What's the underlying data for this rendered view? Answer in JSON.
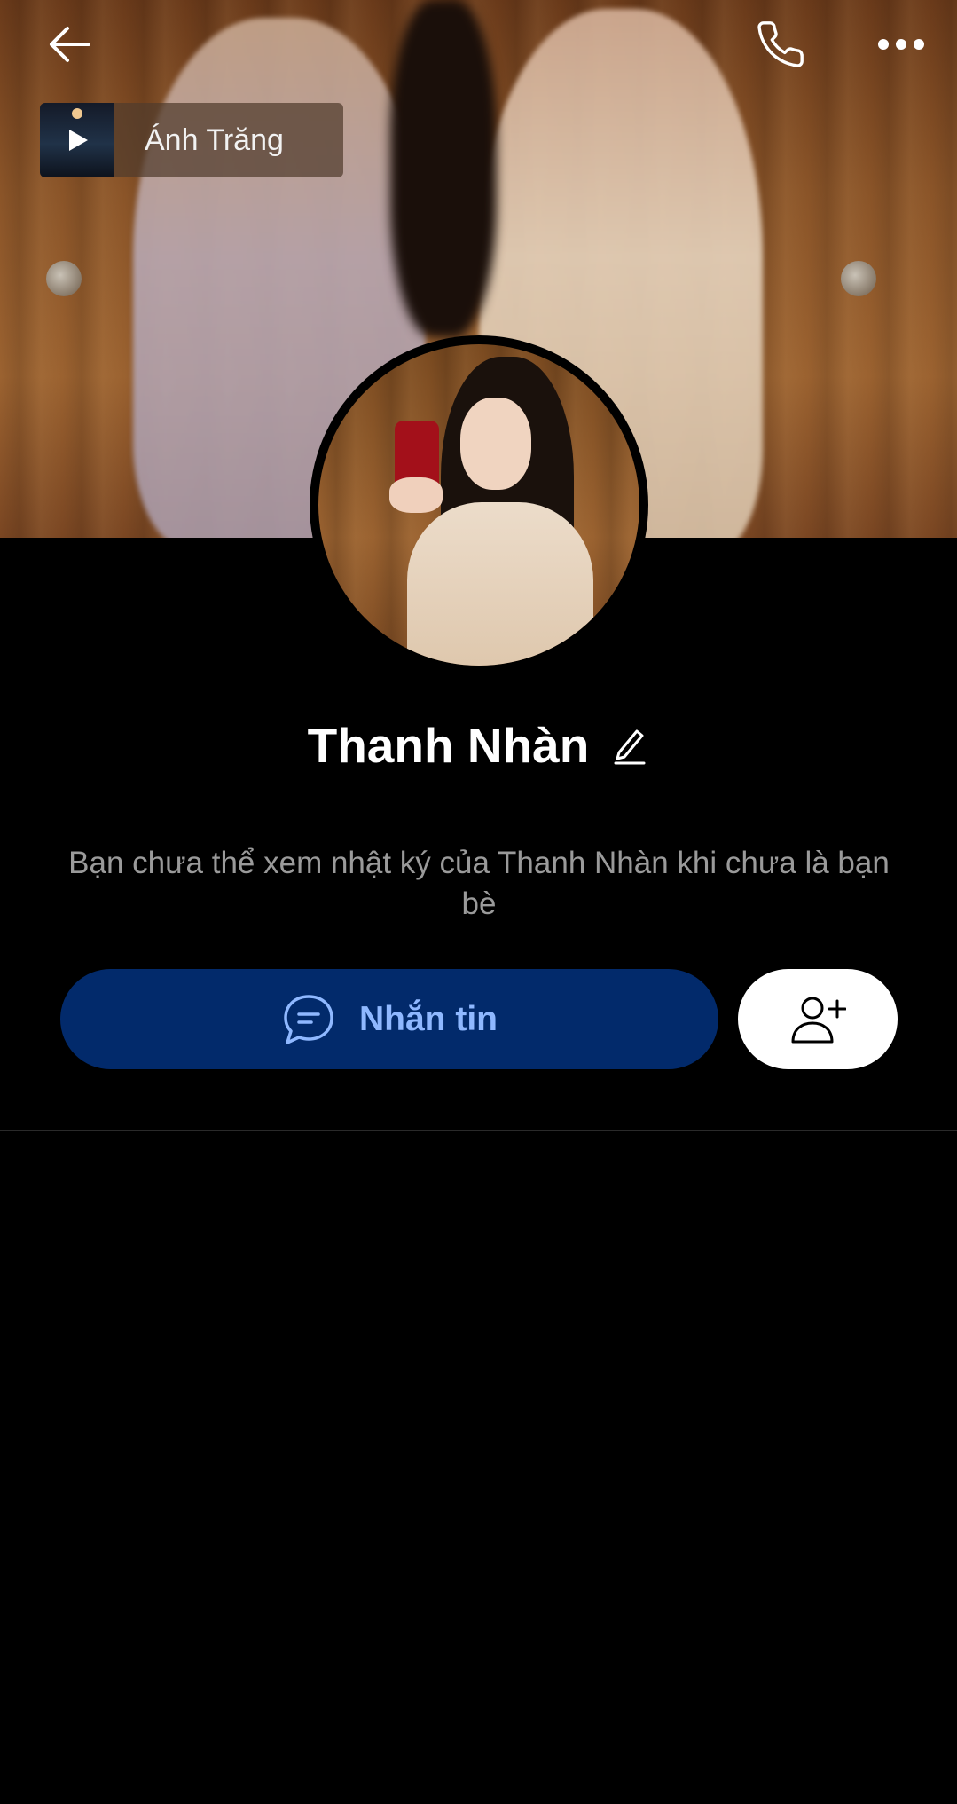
{
  "header": {
    "back_icon": "arrow-left-icon",
    "call_icon": "phone-icon",
    "more_icon": "more-horizontal-icon"
  },
  "music": {
    "title": "Ánh Trăng",
    "play_icon": "play-icon"
  },
  "profile": {
    "name": "Thanh Nhàn",
    "edit_icon": "pencil-icon"
  },
  "notice": {
    "text": "Bạn chưa thể xem nhật ký của Thanh Nhàn khi chưa là bạn bè"
  },
  "actions": {
    "message_label": "Nhắn tin",
    "message_icon": "chat-bubble-icon",
    "add_friend_icon": "user-plus-icon"
  },
  "colors": {
    "background": "#000000",
    "message_button_bg": "#022a6b",
    "message_button_text": "#8fb8ff",
    "add_friend_bg": "#ffffff",
    "notice_text": "#9a9a9a"
  }
}
